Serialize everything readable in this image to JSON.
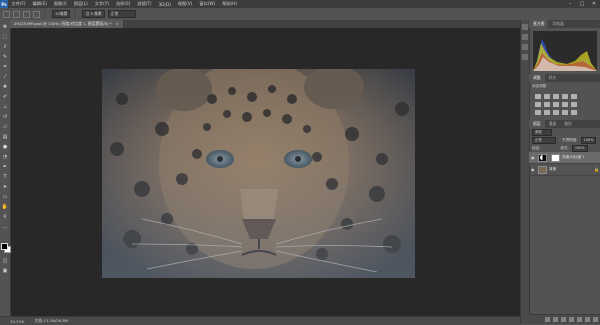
{
  "app": {
    "logo": "Ps",
    "menu": [
      "文件(F)",
      "编辑(E)",
      "图像(I)",
      "图层(L)",
      "文字(Y)",
      "选择(S)",
      "滤镜(T)",
      "3D(D)",
      "视图(V)",
      "窗口(W)",
      "帮助(H)"
    ],
    "window_controls": [
      "–",
      "□",
      "✕"
    ]
  },
  "options_bar": {
    "size_field": "15像素",
    "tool_field": "沿 5 像素",
    "mode_field": "正常"
  },
  "document_tab": {
    "label": "29125.MM.psd @ 100% (亮度/对比度 1, 图层蒙版/8) *",
    "close": "×"
  },
  "tools": [
    "move-icon",
    "marquee-icon",
    "lasso-icon",
    "quick-select-icon",
    "crop-icon",
    "eyedropper-icon",
    "healing-icon",
    "brush-icon",
    "stamp-icon",
    "history-brush-icon",
    "eraser-icon",
    "gradient-icon",
    "blur-icon",
    "dodge-icon",
    "pen-icon",
    "type-icon",
    "path-select-icon",
    "shape-icon",
    "hand-icon",
    "zoom-icon",
    "more-icon"
  ],
  "status_bar": {
    "zoom": "33.33%",
    "doc_info": "文档:13.2M/26.8M"
  },
  "panels": {
    "histogram_tab": "直方图",
    "histogram_tab2": "导航器",
    "adjustments_tab": "调整",
    "adjustments_tab2": "样式",
    "adjustments_title": "添加调整",
    "layers_tabs": [
      "图层",
      "通道",
      "路径"
    ],
    "kind_label": "类型",
    "blend_mode": "正常",
    "opacity_label": "不透明度:",
    "opacity_value": "100%",
    "lock_label": "锁定:",
    "fill_label": "填充:",
    "fill_value": "100%",
    "layers": [
      {
        "name": "亮度/对比度 1",
        "selected": true
      },
      {
        "name": "背景",
        "selected": false
      }
    ]
  },
  "colors": {
    "ui_bg": "#535353",
    "canvas_bg": "#282828",
    "accent": "#2a62a6"
  }
}
